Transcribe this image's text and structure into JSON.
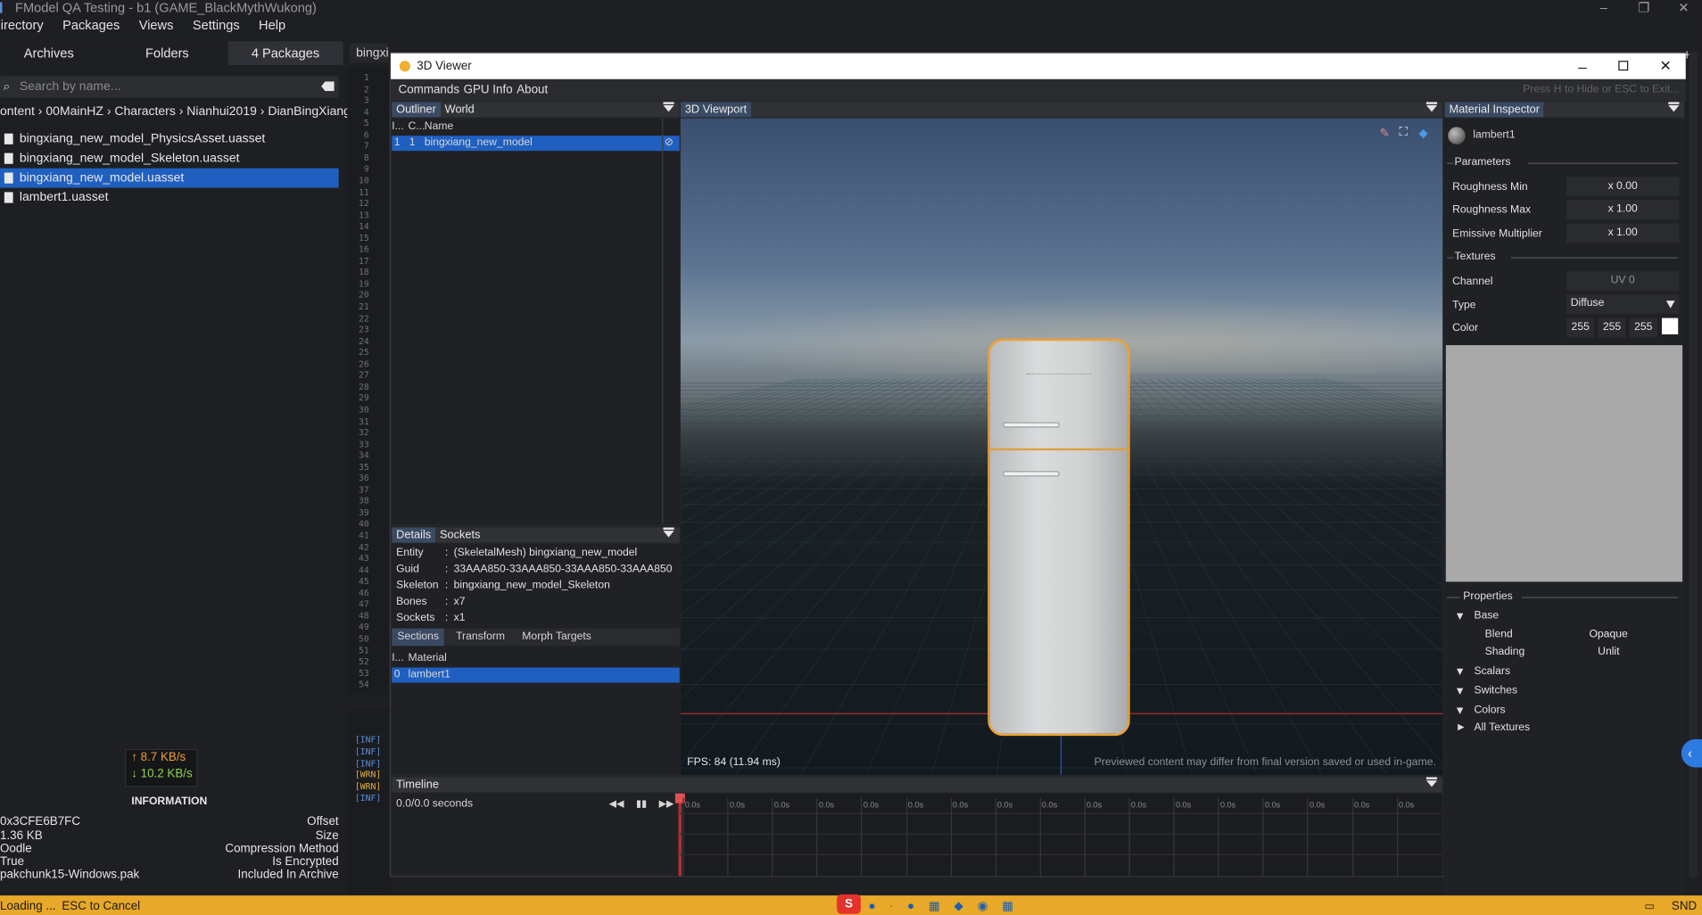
{
  "app": {
    "title": "FModel QA Testing - b1 (GAME_BlackMythWukong)",
    "menu": [
      "Directory",
      "Packages",
      "Views",
      "Settings",
      "Help"
    ]
  },
  "left": {
    "tabs": [
      "Archives",
      "Folders",
      "4 Packages"
    ],
    "search_placeholder": "Search by name...",
    "breadcrumb": [
      "ontent",
      "00MainHZ",
      "Characters",
      "Nianhui2019",
      "DianBingXiang"
    ],
    "files": [
      "bingxiang_new_model_PhysicsAsset.uasset",
      "bingxiang_new_model_Skeleton.uasset",
      "bingxiang_new_model.uasset",
      "lambert1.uasset"
    ],
    "selected_file": 2,
    "net_up": "↑ 8.7 KB/s",
    "net_down": "↓ 10.2 KB/s",
    "info_title": "INFORMATION",
    "info": [
      {
        "value": "0x3CFE6B7FC",
        "label": "Offset"
      },
      {
        "value": "1.36 KB",
        "label": "Size"
      },
      {
        "value": "Oodle",
        "label": "Compression Method"
      },
      {
        "value": "True",
        "label": "Is Encrypted"
      },
      {
        "value": "pakchunk15-Windows.pak",
        "label": "Included In Archive"
      }
    ]
  },
  "editor": {
    "tab1": "bingxia",
    "line_numbers": [
      "1",
      "2",
      "3",
      "4",
      "5",
      "6",
      "7",
      "8",
      "9",
      "10",
      "11",
      "12",
      "13",
      "14",
      "15",
      "16",
      "17",
      "18",
      "19",
      "20",
      "21",
      "22",
      "23",
      "24",
      "25",
      "26",
      "27",
      "28",
      "29",
      "30",
      "31",
      "32",
      "33",
      "34",
      "35",
      "36",
      "37",
      "38",
      "39",
      "40",
      "41",
      "42",
      "43",
      "44",
      "45",
      "46",
      "47",
      "48",
      "49",
      "50",
      "51",
      "52",
      "53",
      "54"
    ],
    "logs": [
      "[INF]",
      "[INF]",
      "[INF]",
      "[WRN]",
      "[WRN]",
      "[INF]"
    ]
  },
  "status": {
    "left": "Loading ...",
    "cancel": "ESC to Cancel",
    "right": "SND"
  },
  "viewer": {
    "title": "3D Viewer",
    "menu": [
      "Commands",
      "GPU Info",
      "About"
    ],
    "hint": "Press H to Hide or ESC to Exit...",
    "outliner": {
      "tabs": [
        "Outliner",
        "World"
      ],
      "cols": [
        "I...",
        "C...",
        "Name"
      ],
      "row": {
        "i": "1",
        "c": "1",
        "name": "bingxiang_new_model"
      }
    },
    "details": {
      "tabs": [
        "Details",
        "Sockets"
      ],
      "rows": [
        {
          "k": "Entity",
          "v": "(SkeletalMesh) bingxiang_new_model"
        },
        {
          "k": "Guid",
          "v": "33AAA850-33AAA850-33AAA850-33AAA850"
        },
        {
          "k": "Skeleton",
          "v": "bingxiang_new_model_Skeleton"
        },
        {
          "k": "Bones",
          "v": "x7"
        },
        {
          "k": "Sockets",
          "v": "x1"
        }
      ],
      "subtabs": [
        "Sections",
        "Transform",
        "Morph Targets"
      ],
      "cols": [
        "I...",
        "Material"
      ],
      "section": {
        "i": "0",
        "name": "lambert1"
      }
    },
    "viewport": {
      "title": "3D Viewport",
      "fps": "FPS: 84 (11.94 ms)",
      "disclaimer": "Previewed content may differ from final version saved or used in-game."
    },
    "timeline": {
      "title": "Timeline",
      "time": "0.0/0.0 seconds",
      "tick_label": "0.0s"
    },
    "material": {
      "title": "Material Inspector",
      "name": "lambert1",
      "parameters": "Parameters",
      "params": [
        {
          "k": "Roughness Min",
          "v": "x 0.00"
        },
        {
          "k": "Roughness Max",
          "v": "x 1.00"
        },
        {
          "k": "Emissive Multiplier",
          "v": "x 1.00"
        }
      ],
      "textures": "Textures",
      "channel_label": "Channel",
      "channel_value": "UV 0",
      "type_label": "Type",
      "type_value": "Diffuse",
      "color_label": "Color",
      "color_rgb": [
        "255",
        "255",
        "255"
      ],
      "properties": "Properties",
      "base": "Base",
      "blend_label": "Blend",
      "blend_value": "Opaque",
      "shading_label": "Shading",
      "shading_value": "Unlit",
      "groups": [
        "Scalars",
        "Switches",
        "Colors",
        "All Textures"
      ]
    }
  },
  "colors": {
    "accent": "#1f5fbf",
    "status_bar": "#e8a82a",
    "selection_outline": "#f0a030"
  }
}
